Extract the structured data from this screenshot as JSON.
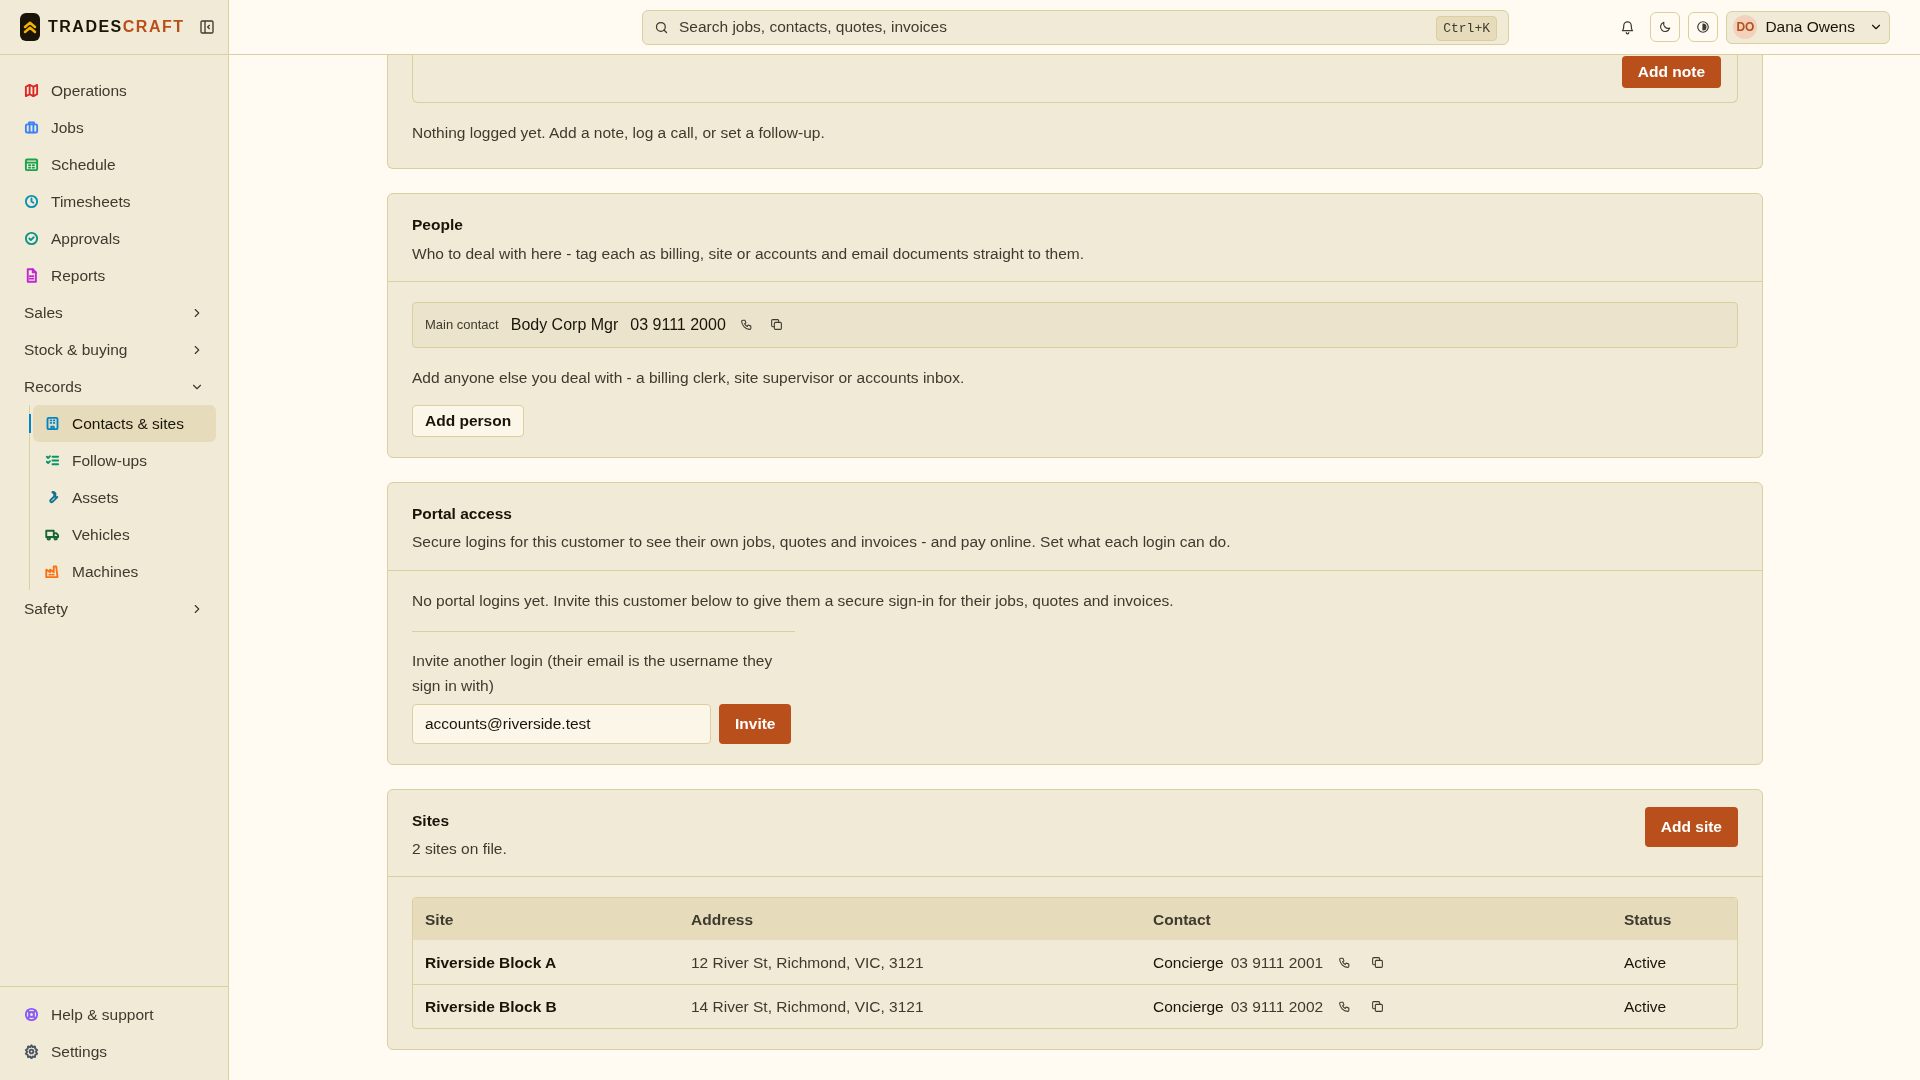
{
  "brand": {
    "name_part_1": "TRADES",
    "name_part_2": "CRAFT"
  },
  "sidebar": {
    "items": [
      {
        "label": "Operations",
        "color": "#dc2626"
      },
      {
        "label": "Jobs",
        "color": "#3b82f6"
      },
      {
        "label": "Schedule",
        "color": "#16a34a"
      },
      {
        "label": "Timesheets",
        "color": "#0891b2"
      },
      {
        "label": "Approvals",
        "color": "#0d9488"
      },
      {
        "label": "Reports",
        "color": "#c026d3"
      }
    ],
    "groups": [
      {
        "label": "Sales",
        "expanded": false
      },
      {
        "label": "Stock & buying",
        "expanded": false
      },
      {
        "label": "Records",
        "expanded": true,
        "children": [
          {
            "label": "Contacts & sites",
            "selected": true,
            "color": "#0284c7"
          },
          {
            "label": "Follow-ups",
            "selected": false,
            "color": "#059669"
          },
          {
            "label": "Assets",
            "selected": false,
            "color": "#0e7490"
          },
          {
            "label": "Vehicles",
            "selected": false,
            "color": "#166534"
          },
          {
            "label": "Machines",
            "selected": false,
            "color": "#f97316"
          }
        ]
      },
      {
        "label": "Safety",
        "expanded": false
      }
    ],
    "footer": [
      {
        "label": "Help & support",
        "color": "#8b5cf6"
      },
      {
        "label": "Settings",
        "color": "#4b5563"
      }
    ]
  },
  "topbar": {
    "search": {
      "placeholder": "Search jobs, contacts, quotes, invoices",
      "shortcut": "Ctrl+K"
    },
    "user": {
      "initials": "DO",
      "name": "Dana Owens"
    }
  },
  "activity": {
    "button": "Add note",
    "empty": "Nothing logged yet. Add a note, log a call, or set a follow-up."
  },
  "people": {
    "title": "People",
    "subtitle": "Who to deal with here - tag each as billing, site or accounts and email documents straight to them.",
    "main_contact": {
      "tag": "Main contact",
      "name": "Body Corp Mgr",
      "phone": "03 9111 2000"
    },
    "hint": "Add anyone else you deal with - a billing clerk, site supervisor or accounts inbox.",
    "button": "Add person"
  },
  "portal": {
    "title": "Portal access",
    "subtitle": "Secure logins for this customer to see their own jobs, quotes and invoices - and pay online. Set what each login can do.",
    "empty": "No portal logins yet. Invite this customer below to give them a secure sign-in for their jobs, quotes and invoices.",
    "invite_label": "Invite another login (their email is the username they sign in with)",
    "email": "accounts@riverside.test",
    "button": "Invite"
  },
  "sites": {
    "title": "Sites",
    "subtitle": "2 sites on file.",
    "button": "Add site",
    "columns": [
      "Site",
      "Address",
      "Contact",
      "Status"
    ],
    "rows": [
      {
        "site": "Riverside Block A",
        "address": "12 River St, Richmond, VIC, 3121",
        "contact": "Concierge",
        "phone": "03 9111 2001",
        "status": "Active"
      },
      {
        "site": "Riverside Block B",
        "address": "14 River St, Richmond, VIC, 3121",
        "contact": "Concierge",
        "phone": "03 9111 2002",
        "status": "Active"
      }
    ]
  }
}
